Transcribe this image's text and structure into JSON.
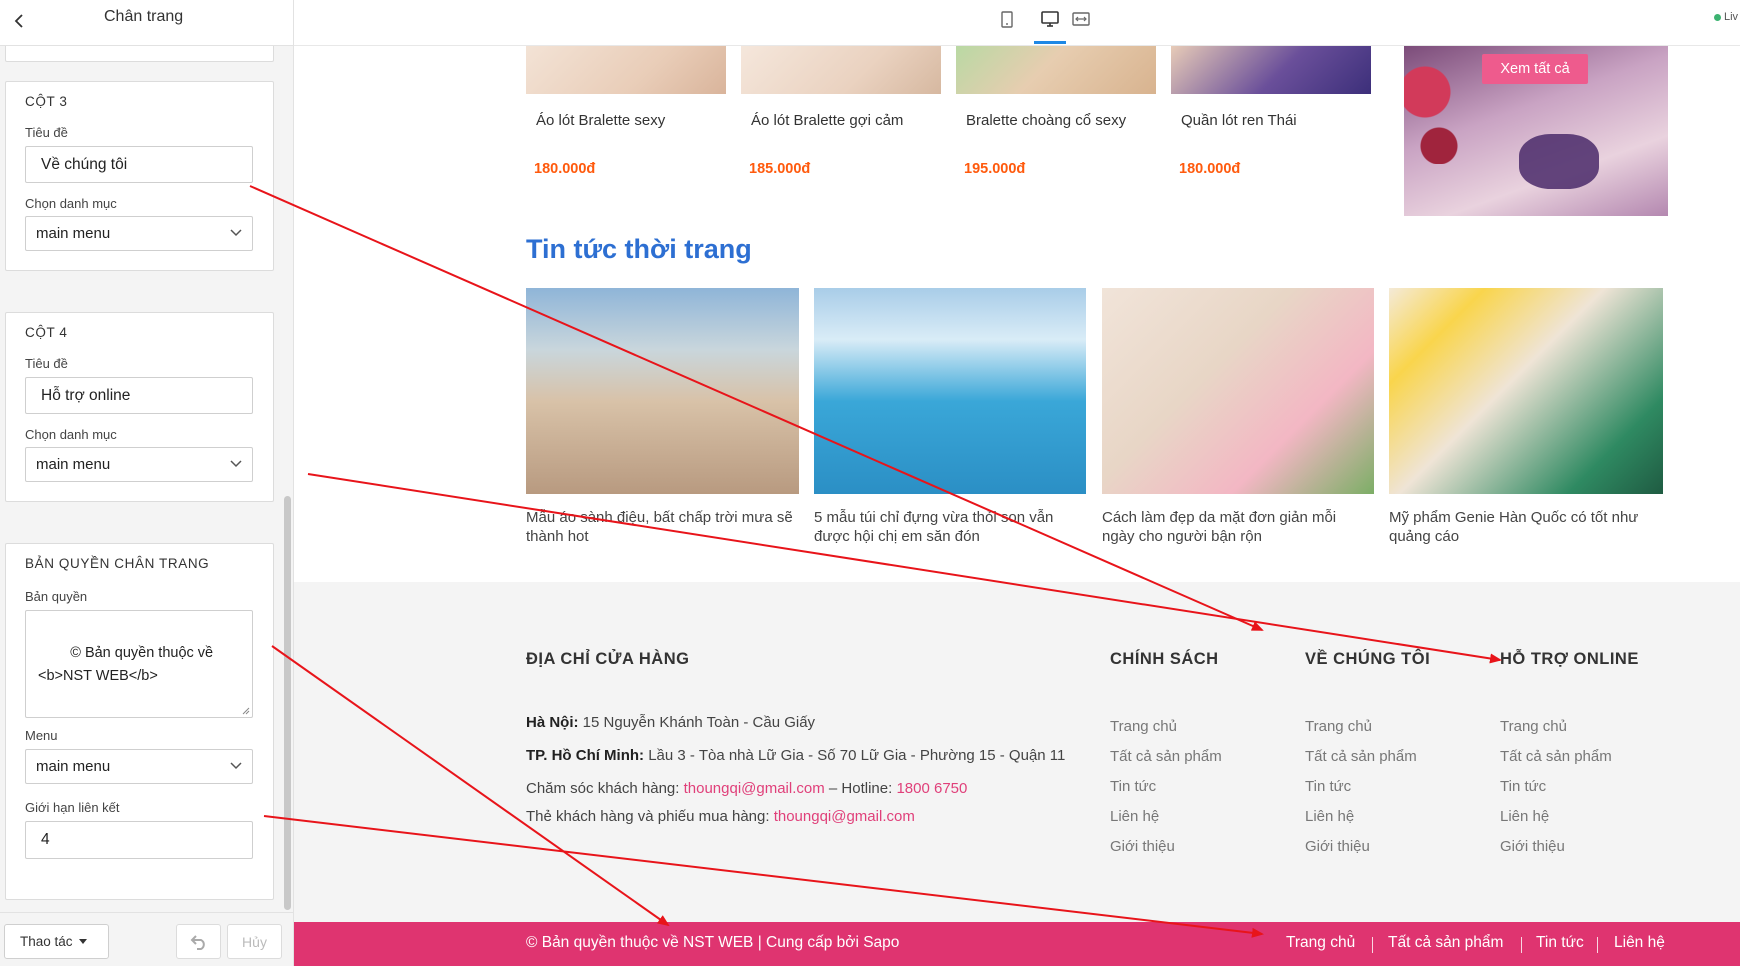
{
  "sidebar": {
    "title": "Chân trang",
    "col3": {
      "heading": "CỘT 3",
      "title_label": "Tiêu đề",
      "title_value": "Về chúng tôi",
      "menu_label": "Chọn danh mục",
      "menu_value": "main menu"
    },
    "col4": {
      "heading": "CỘT 4",
      "title_label": "Tiêu đề",
      "title_value": "Hỗ trợ online",
      "menu_label": "Chọn danh mục",
      "menu_value": "main menu"
    },
    "copyright": {
      "heading": "BẢN QUYỀN CHÂN TRANG",
      "label": "Bản quyền",
      "value": "© Bản quyền thuộc về <b>NST WEB</b>",
      "menu_label": "Menu",
      "menu_value": "main menu",
      "limit_label": "Giới hạn liên kết",
      "limit_value": "4"
    },
    "footer": {
      "actions_label": "Thao tác",
      "cancel_label": "Hủy"
    }
  },
  "topbar": {
    "live_label": "Liv"
  },
  "preview": {
    "products": [
      {
        "name": "Áo lót Bralette sexy",
        "price": "180.000đ"
      },
      {
        "name": "Áo lót Bralette gợi cảm",
        "price": "185.000đ"
      },
      {
        "name": "Bralette choàng cổ sexy",
        "price": "195.000đ"
      },
      {
        "name": "Quần lót ren Thái",
        "price": "180.000đ"
      }
    ],
    "banner_button": "Xem tất cả",
    "news_heading": "Tin tức thời trang",
    "news": [
      {
        "title": "Mẫu áo sành điệu, bất chấp trời mưa sẽ thành hot"
      },
      {
        "title": "5 mẫu túi chỉ đựng vừa thỏi son vẫn được hội chị em săn đón"
      },
      {
        "title": "Cách làm đẹp da mặt đơn giản mỗi ngày cho người bận rộn"
      },
      {
        "title": "Mỹ phẩm Genie Hàn Quốc có tốt như quảng cáo"
      }
    ],
    "footer": {
      "address_heading": "ĐỊA CHỈ CỬA HÀNG",
      "hanoi_label": "Hà Nội:",
      "hanoi_value": "15 Nguyễn Khánh Toàn - Cầu Giấy",
      "hcm_label": "TP. Hồ Chí Minh:",
      "hcm_value": "Lầu 3 - Tòa nhà Lữ Gia - Số 70 Lữ Gia - Phường 15 - Quận 11",
      "care_label": "Chăm sóc khách hàng:",
      "care_email": "thoungqi@gmail.com",
      "hotline_label": "– Hotline:",
      "hotline_value": "1800 6750",
      "card_label": "Thẻ khách hàng và phiếu mua hàng:",
      "card_email": "thoungqi@gmail.com",
      "columns": [
        {
          "heading": "CHÍNH SÁCH",
          "links": [
            "Trang chủ",
            "Tất cả sản phẩm",
            "Tin tức",
            "Liên hệ",
            "Giới thiệu"
          ]
        },
        {
          "heading": "VỀ CHÚNG TÔI",
          "links": [
            "Trang chủ",
            "Tất cả sản phẩm",
            "Tin tức",
            "Liên hệ",
            "Giới thiệu"
          ]
        },
        {
          "heading": "HỖ TRỢ ONLINE",
          "links": [
            "Trang chủ",
            "Tất cả sản phẩm",
            "Tin tức",
            "Liên hệ",
            "Giới thiệu"
          ]
        }
      ]
    },
    "copybar": {
      "text": "© Bản quyền thuộc về NST WEB | Cung cấp bởi Sapo",
      "links": [
        "Trang chủ",
        "Tất cả sản phẩm",
        "Tin tức",
        "Liên hệ"
      ]
    }
  },
  "colors": {
    "accent_pink": "#df3470",
    "news_heading_blue": "#2d6fd2",
    "price_orange": "#ff5a0d",
    "annotation_red": "#e8141a"
  }
}
